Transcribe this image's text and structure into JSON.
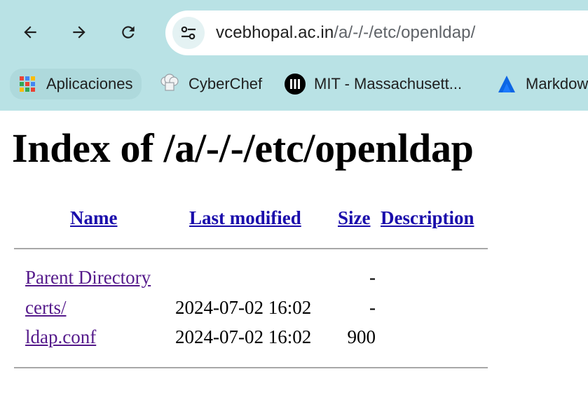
{
  "browser": {
    "url_host": "vcebhopal.ac.in",
    "url_path": "/a/-/-/etc/openldap/",
    "icons": {
      "back": "arrow-left-icon",
      "forward": "arrow-right-icon",
      "reload": "reload-icon",
      "site_info": "tune-icon"
    }
  },
  "bookmarks": [
    {
      "label": "Aplicaciones",
      "icon": "apps-grid-icon"
    },
    {
      "label": "CyberChef",
      "icon": "chef-hat-icon"
    },
    {
      "label": "MIT - Massachusett...",
      "icon": "mit-logo-icon"
    },
    {
      "label": "Markdow",
      "icon": "atlassian-logo-icon"
    }
  ],
  "page": {
    "title": "Index of /a/-/-/etc/openldap",
    "columns": {
      "name": "Name",
      "last_modified": "Last modified",
      "size": "Size",
      "description": "Description"
    },
    "rows": [
      {
        "name": "Parent Directory",
        "modified": "",
        "size": "-",
        "description": ""
      },
      {
        "name": "certs/",
        "modified": "2024-07-02 16:02",
        "size": "-",
        "description": ""
      },
      {
        "name": "ldap.conf",
        "modified": "2024-07-02 16:02",
        "size": "900",
        "description": ""
      }
    ]
  },
  "colors": {
    "chrome_bg": "#b9e2e5",
    "link": "#1a0dab",
    "visited_link": "#551a8b",
    "rule": "#a8a8a8"
  }
}
